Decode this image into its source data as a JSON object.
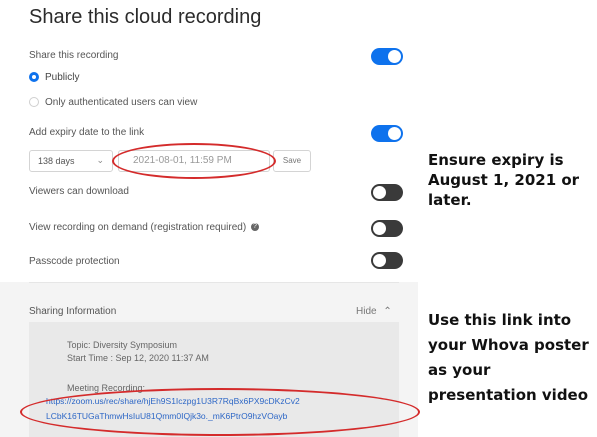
{
  "panel": {
    "title": "Share this cloud recording",
    "share": {
      "label": "Share this recording",
      "options": [
        "Publicly",
        "Only authenticated users can view"
      ]
    },
    "expiry": {
      "label": "Add expiry date to the link",
      "days_value": "138 days",
      "date_value": "2021-08-01, 11:59 PM",
      "save_label": "Save"
    },
    "viewers_download": "Viewers can download",
    "view_on_demand": "View recording on demand (registration required)",
    "passcode": "Passcode protection",
    "sharing_info": {
      "label": "Sharing Information",
      "hide_label": "Hide",
      "topic": "Topic: Diversity Symposium",
      "start_time": "Start Time : Sep 12, 2020 11:37 AM",
      "meeting_recording": "Meeting Recording:",
      "link_line1": "https://zoom.us/rec/share/hjEh9S1Iczpg1U3R7RqBx6PX9cDKzCv2",
      "link_line2": "LCbK16TUGaThmwHsIuU81Qmm0IQjk3o._mK6PtrO9hzVOayb"
    }
  },
  "toggles": {
    "share": "on",
    "expiry": "on",
    "download": "off",
    "on_demand": "off",
    "passcode": "off"
  },
  "annotations": {
    "expiry_note": [
      "Ensure expiry is",
      "August 1, 2021 or",
      "later."
    ],
    "link_note": [
      "Use this link into",
      "your Whova poster",
      "as your",
      "presentation video"
    ]
  },
  "colors": {
    "accent": "#0e72ed",
    "annotation_red": "#d42b2b"
  }
}
